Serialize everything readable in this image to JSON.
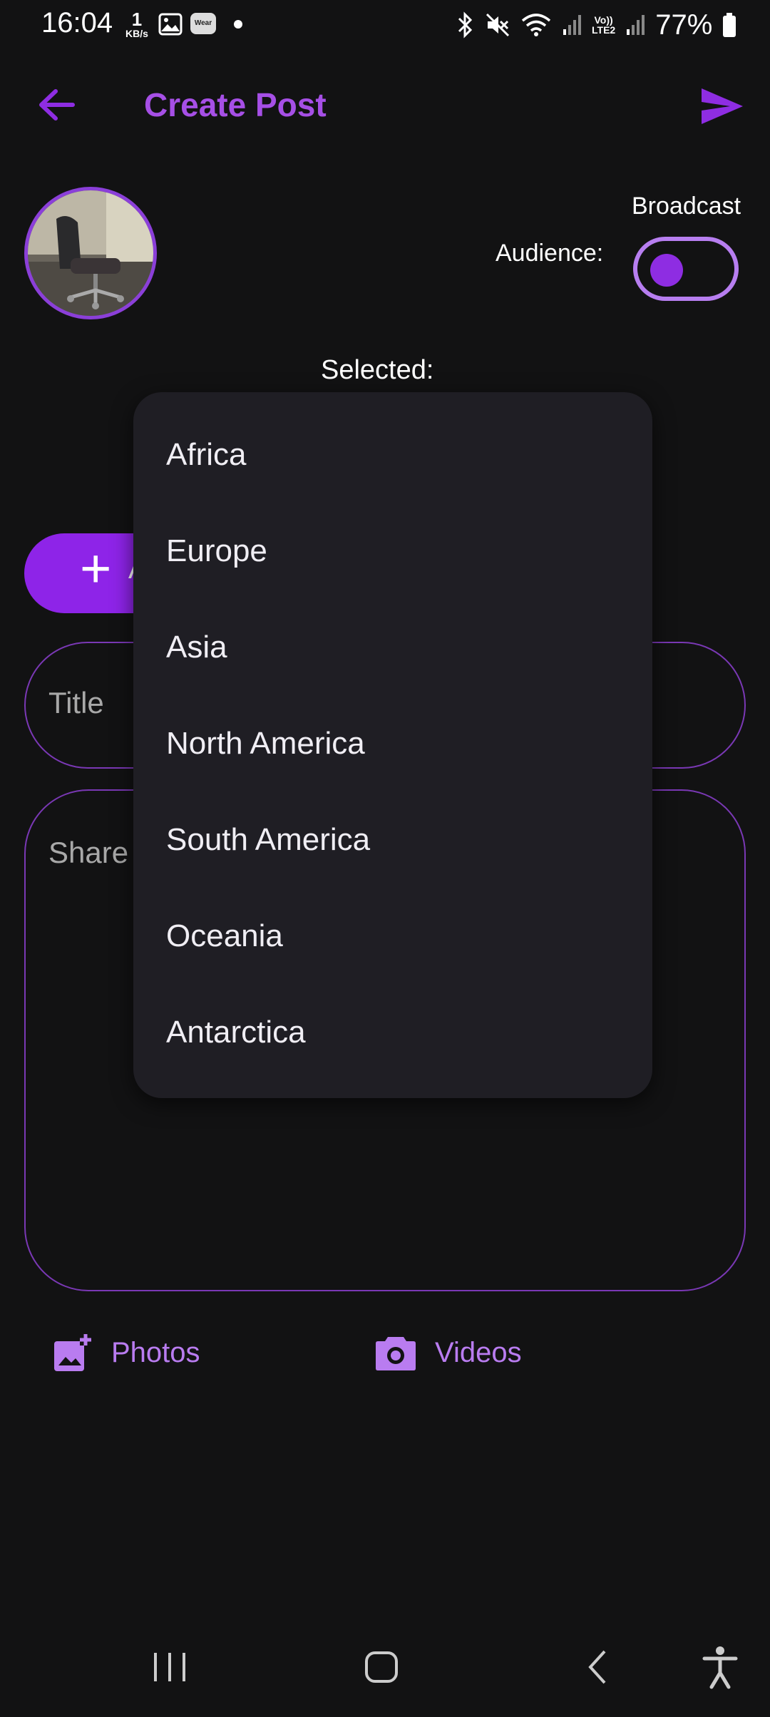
{
  "status_bar": {
    "time": "16:04",
    "net_speed_value": "1",
    "net_speed_unit": "KB/s",
    "wear_label": "Wear",
    "lte_label_top": "Vo))",
    "lte_label_bottom": "LTE2",
    "battery": "77%"
  },
  "header": {
    "title": "Create Post"
  },
  "audience": {
    "broadcast_label": "Broadcast",
    "audience_label": "Audience:",
    "toggle_on": true
  },
  "selected_label": "Selected:",
  "add_button": {
    "label": "A"
  },
  "form": {
    "title_placeholder": "Title",
    "body_placeholder": "Share"
  },
  "media": {
    "photos_label": "Photos",
    "videos_label": "Videos"
  },
  "dropdown": {
    "items": [
      "Africa",
      "Europe",
      "Asia",
      "North America",
      "South America",
      "Oceania",
      "Antarctica"
    ]
  },
  "colors": {
    "accent": "#8e24e8",
    "title": "#a64fe6",
    "background": "#121213",
    "menu_bg": "#1f1e24"
  }
}
